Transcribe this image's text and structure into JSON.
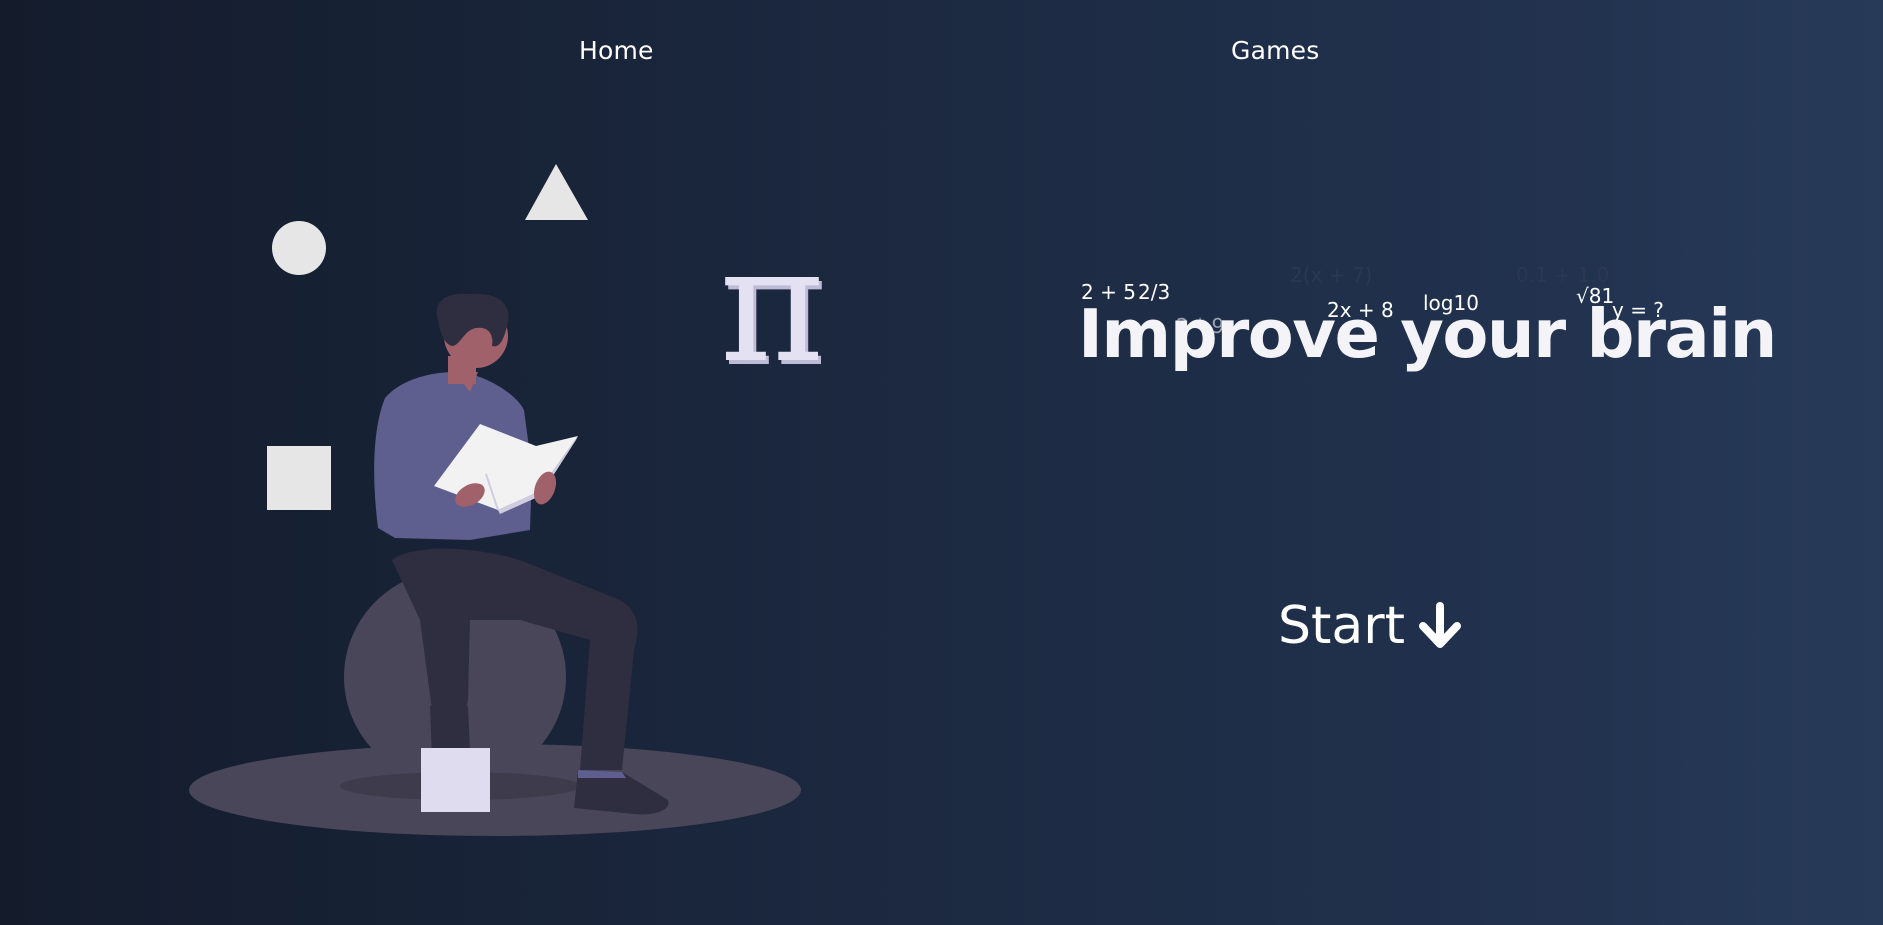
{
  "nav": {
    "home_label": "Home",
    "games_label": "Games"
  },
  "hero": {
    "title": "Improve your brain",
    "formulas": [
      "2 + 5",
      "2/3",
      "2(x + 7)",
      "0.1 + 1.0",
      "2 * 9",
      "2x + 8",
      "log10",
      "√81",
      "y = ?"
    ],
    "start_label": "Start",
    "start_icon": "arrow-down-icon"
  },
  "illustration": {
    "symbol": "π",
    "icons": [
      "circle-shape-icon",
      "triangle-shape-icon",
      "square-shape-icon",
      "pi-symbol-icon",
      "person-reading-icon"
    ]
  },
  "colors": {
    "background_start": "#141c2c",
    "background_end": "#273b59",
    "text": "#ffffff",
    "shapes": "#e6e6e6",
    "shirt": "#5e5e8f",
    "ball": "#4a4659",
    "pants": "#2f2e41",
    "skin": "#a0616a"
  }
}
